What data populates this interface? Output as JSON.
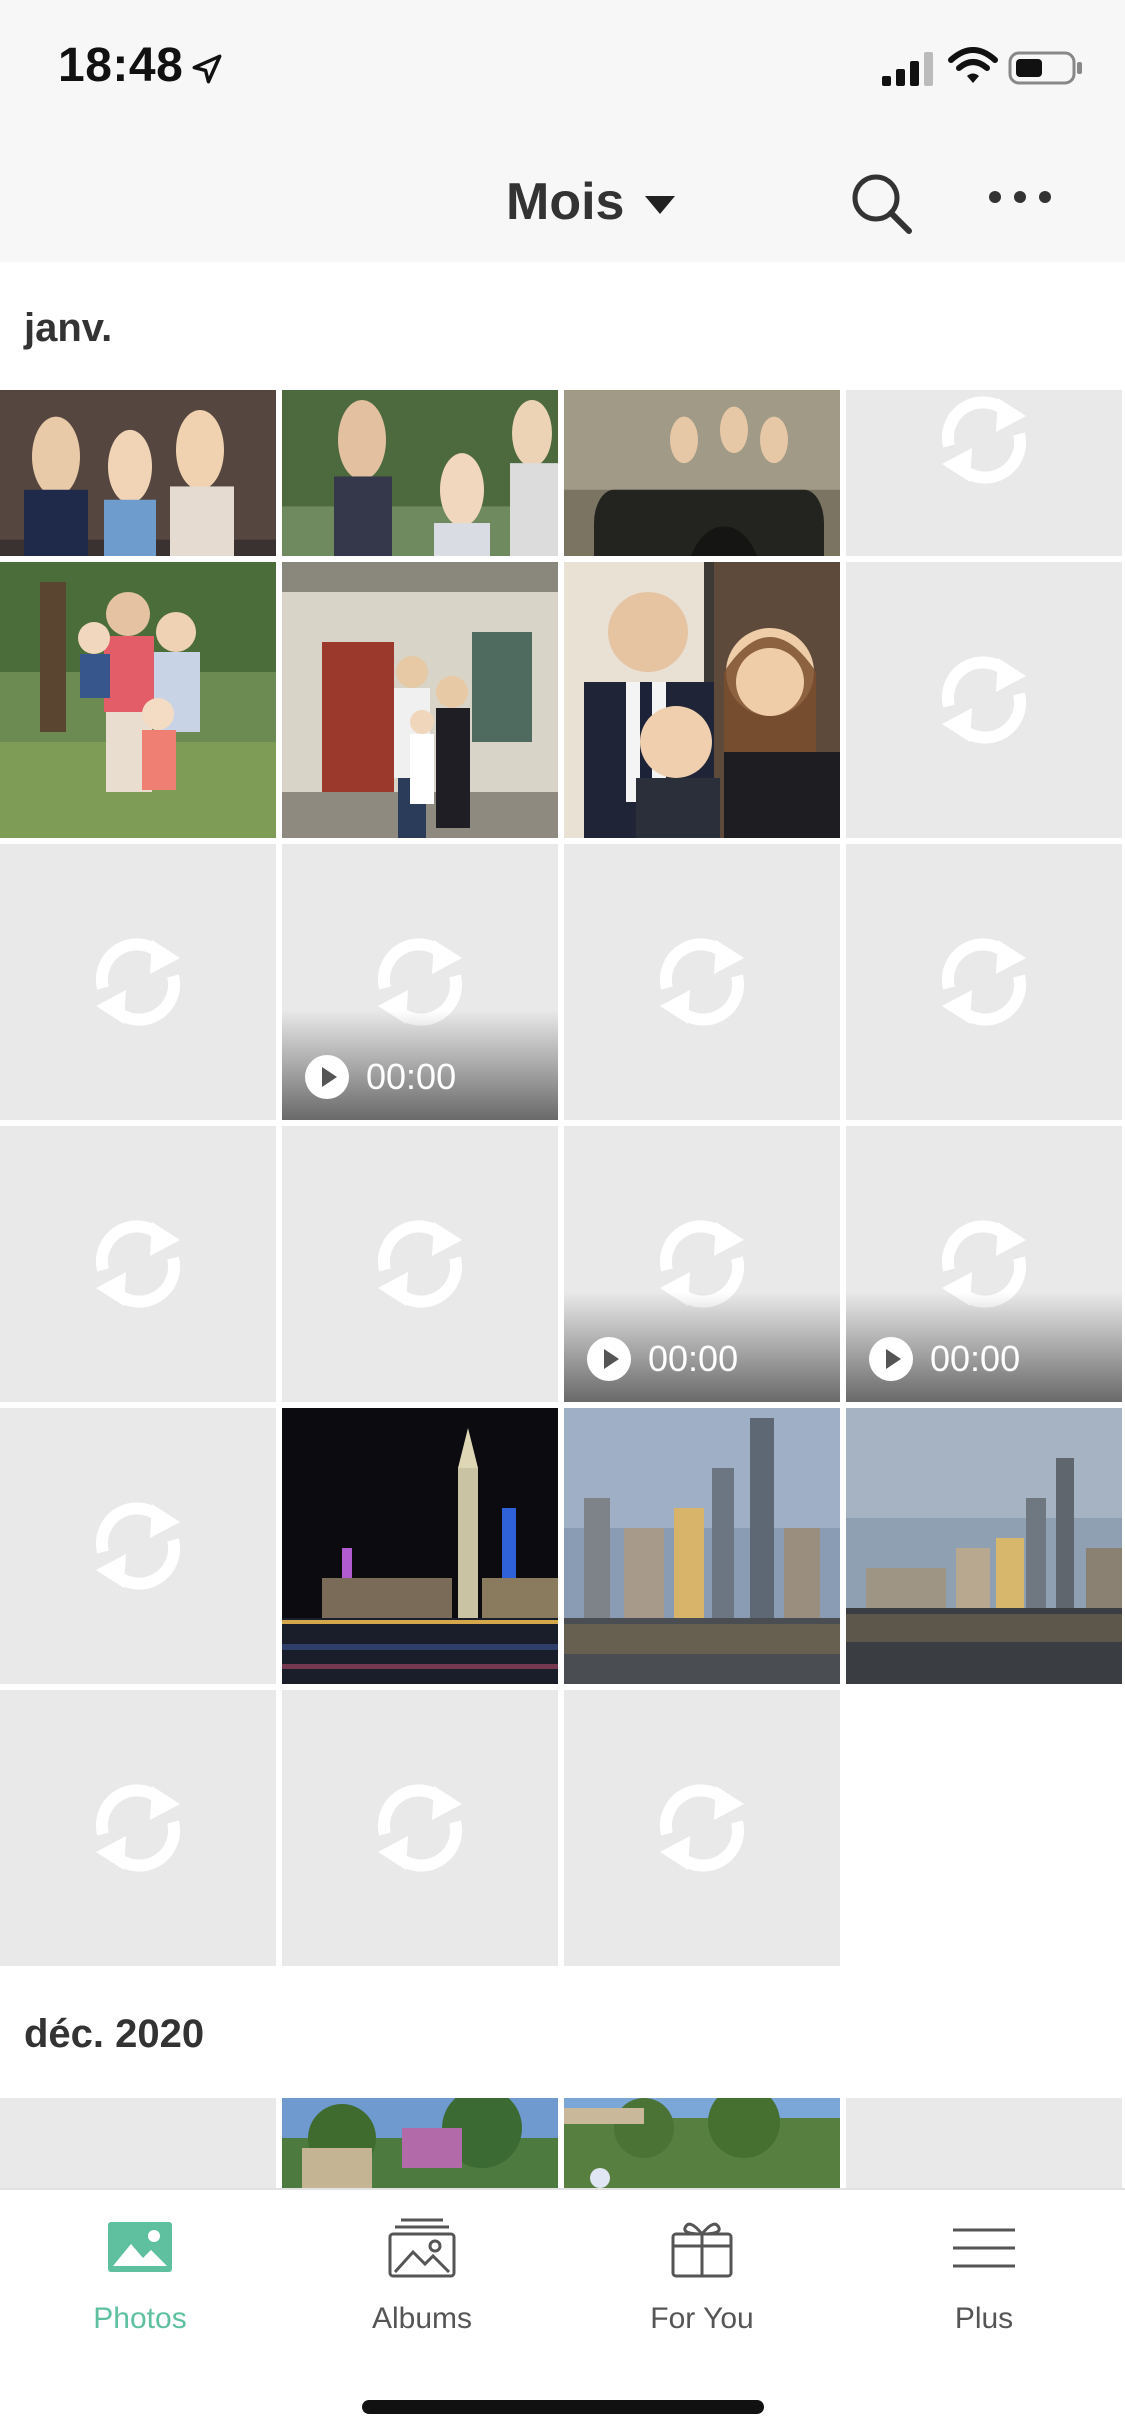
{
  "status_bar": {
    "time": "18:48"
  },
  "header": {
    "title": "Mois"
  },
  "sections": [
    {
      "label": "janv."
    },
    {
      "label": "déc. 2020"
    }
  ],
  "video_duration": "00:00",
  "tabs": [
    {
      "label": "Photos",
      "icon": "photo-icon",
      "active": true
    },
    {
      "label": "Albums",
      "icon": "albums-icon",
      "active": false
    },
    {
      "label": "For You",
      "icon": "gift-icon",
      "active": false
    },
    {
      "label": "Plus",
      "icon": "menu-icon",
      "active": false
    }
  ],
  "colors": {
    "accent": "#5fc0a0",
    "placeholder": "#e9e9e9",
    "header_bg": "#f7f7f7"
  }
}
